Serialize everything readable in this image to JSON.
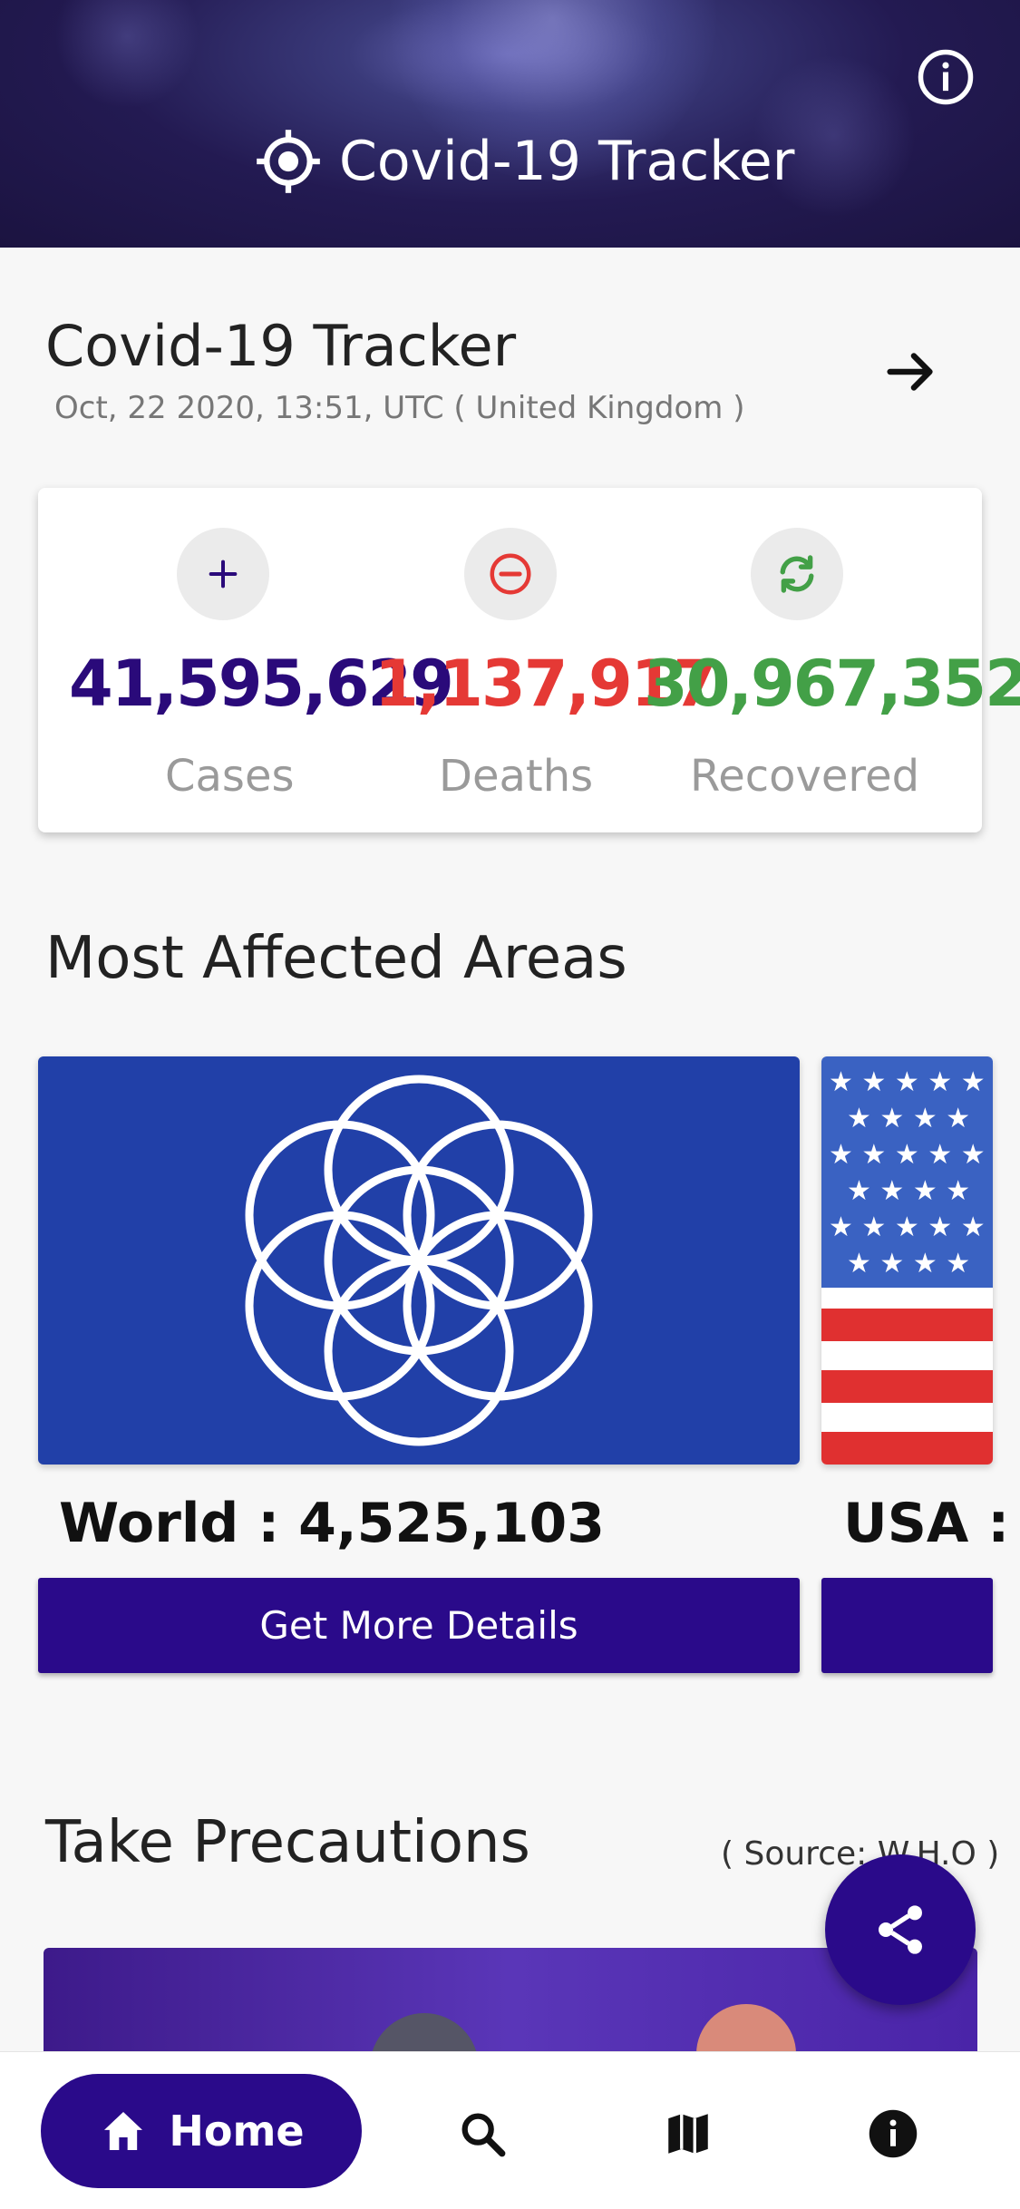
{
  "header": {
    "title": "Covid-19 Tracker",
    "logo_icon": "crosshair-icon",
    "info_icon": "info-icon"
  },
  "summary": {
    "title": "Covid-19 Tracker",
    "timestamp": "Oct, 22 2020, 13:51, UTC ( United Kingdom )",
    "arrow_icon": "arrow-right-icon"
  },
  "stats": [
    {
      "value": "41,595,629",
      "label": "Cases",
      "icon": "plus-icon",
      "color": "#2a0a7a"
    },
    {
      "value": "1,137,917",
      "label": "Deaths",
      "icon": "minus-circle-icon",
      "color": "#e53935"
    },
    {
      "value": "30,967,352",
      "label": "Recovered",
      "icon": "refresh-icon",
      "color": "#43a047"
    }
  ],
  "affected": {
    "title": "Most Affected Areas",
    "cards": [
      {
        "name": "World : 4,525,103",
        "button": "Get More Details",
        "flag": "world-flag"
      },
      {
        "name": "USA :",
        "button": "",
        "flag": "usa-flag"
      }
    ]
  },
  "precautions": {
    "title": "Take Precautions",
    "source": "( Source: W.H.O )"
  },
  "fab": {
    "icon": "share-icon"
  },
  "nav": {
    "home_label": "Home",
    "items": [
      "home-icon",
      "search-icon",
      "map-icon",
      "info-icon"
    ],
    "accent": "#2a0a8a"
  }
}
